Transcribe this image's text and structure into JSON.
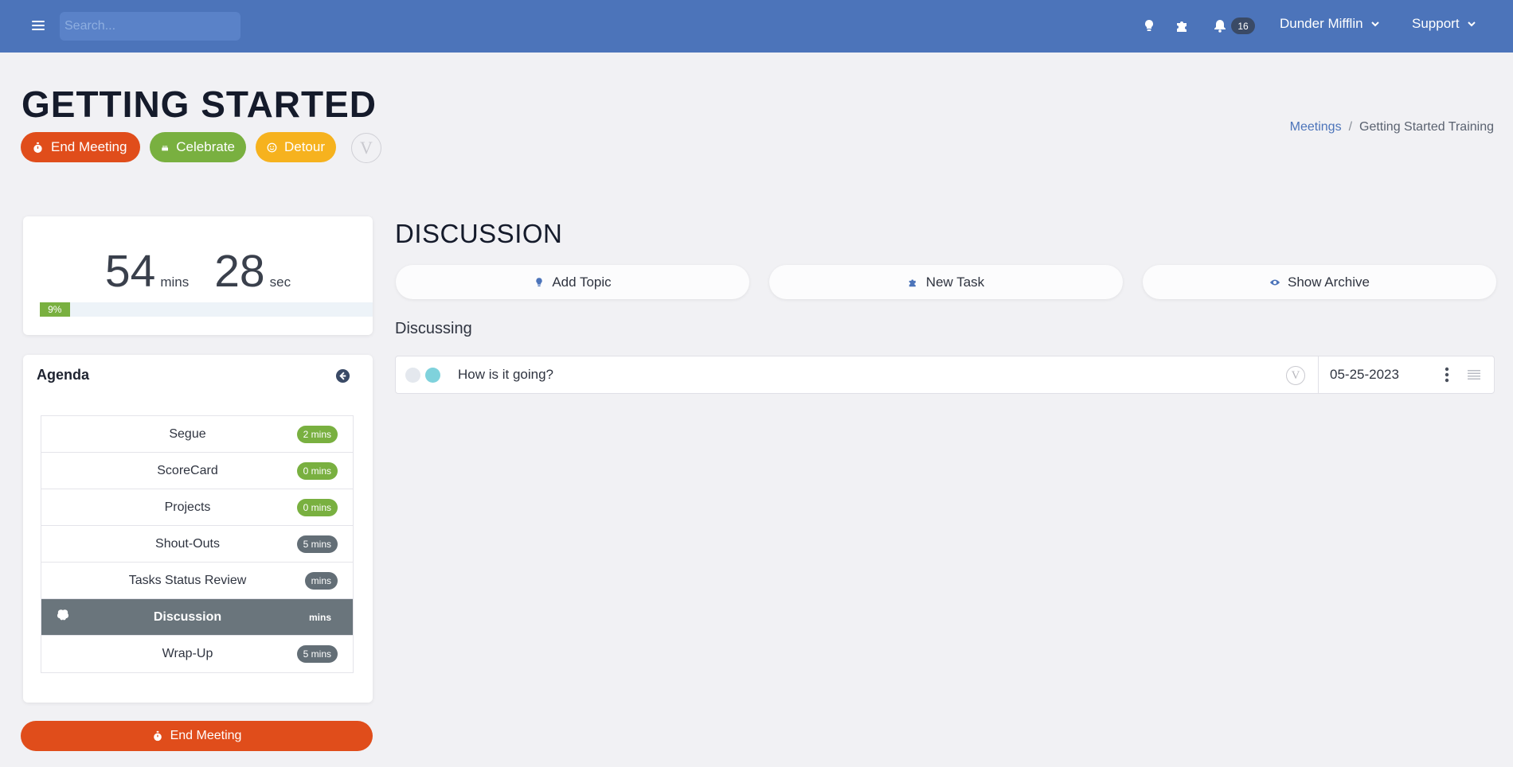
{
  "navbar": {
    "search_placeholder": "Search...",
    "notifications_count": "16",
    "org_name": "Dunder Mifflin",
    "support_label": "Support",
    "icons": [
      "menu-icon",
      "lightbulb-icon",
      "puzzle-icon",
      "bell-icon",
      "chevron-down-icon"
    ]
  },
  "header": {
    "title": "GETTING STARTED",
    "end_meeting_label": "End Meeting",
    "celebrate_label": "Celebrate",
    "detour_label": "Detour",
    "v_logo": "V",
    "breadcrumb": {
      "parent": "Meetings",
      "separator": "/",
      "current": "Getting Started Training"
    }
  },
  "timer": {
    "minutes": "54",
    "minutes_unit": "mins",
    "seconds": "28",
    "seconds_unit": "sec",
    "progress_label": "9%",
    "progress_fraction": 0.09
  },
  "agenda": {
    "title": "Agenda",
    "items": [
      {
        "label": "Segue",
        "duration": "2 mins",
        "badge": "green",
        "active": false
      },
      {
        "label": "ScoreCard",
        "duration": "0 mins",
        "badge": "green",
        "active": false
      },
      {
        "label": "Projects",
        "duration": "0 mins",
        "badge": "green",
        "active": false
      },
      {
        "label": "Shout-Outs",
        "duration": "5 mins",
        "badge": "gray",
        "active": false
      },
      {
        "label": "Tasks Status Review",
        "duration": "mins",
        "badge": "gray",
        "active": false
      },
      {
        "label": "Discussion",
        "duration": "mins",
        "badge": "none",
        "active": true
      },
      {
        "label": "Wrap-Up",
        "duration": "5 mins",
        "badge": "gray",
        "active": false
      }
    ],
    "end_meeting_label": "End Meeting"
  },
  "discussion": {
    "title": "DISCUSSION",
    "add_topic_label": "Add Topic",
    "new_task_label": "New Task",
    "show_archive_label": "Show Archive",
    "subhead": "Discussing",
    "topics": [
      {
        "text": "How is it going?",
        "v_logo": "V",
        "date": "05-25-2023"
      }
    ]
  },
  "colors": {
    "navbar": "#4c74ba",
    "danger": "#e04d1b",
    "success": "#79b040",
    "warning": "#f6b21e",
    "active_row": "#6a757c"
  }
}
